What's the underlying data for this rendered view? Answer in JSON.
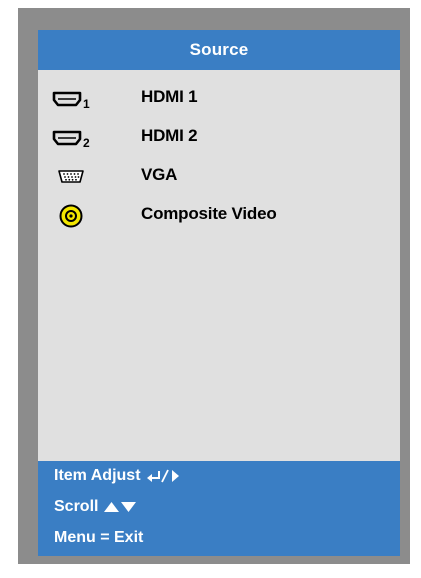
{
  "menu": {
    "title": "Source"
  },
  "sources": [
    {
      "label": "HDMI 1",
      "icon": "hdmi-1-icon",
      "subscript": "1"
    },
    {
      "label": "HDMI 2",
      "icon": "hdmi-2-icon",
      "subscript": "2"
    },
    {
      "label": "VGA",
      "icon": "vga-icon"
    },
    {
      "label": "Composite Video",
      "icon": "composite-video-icon"
    }
  ],
  "help": {
    "item_adjust": "Item Adjust",
    "item_adjust_icons": "enter-and-right-arrow-icon",
    "scroll": "Scroll",
    "scroll_icons": "up-down-arrow-icon",
    "menu_exit": "Menu = Exit"
  },
  "colors": {
    "frame": "#8c8c8c",
    "panel": "#e0e0e0",
    "accent": "#3a7ec4",
    "composite_yellow": "#f2e600"
  }
}
